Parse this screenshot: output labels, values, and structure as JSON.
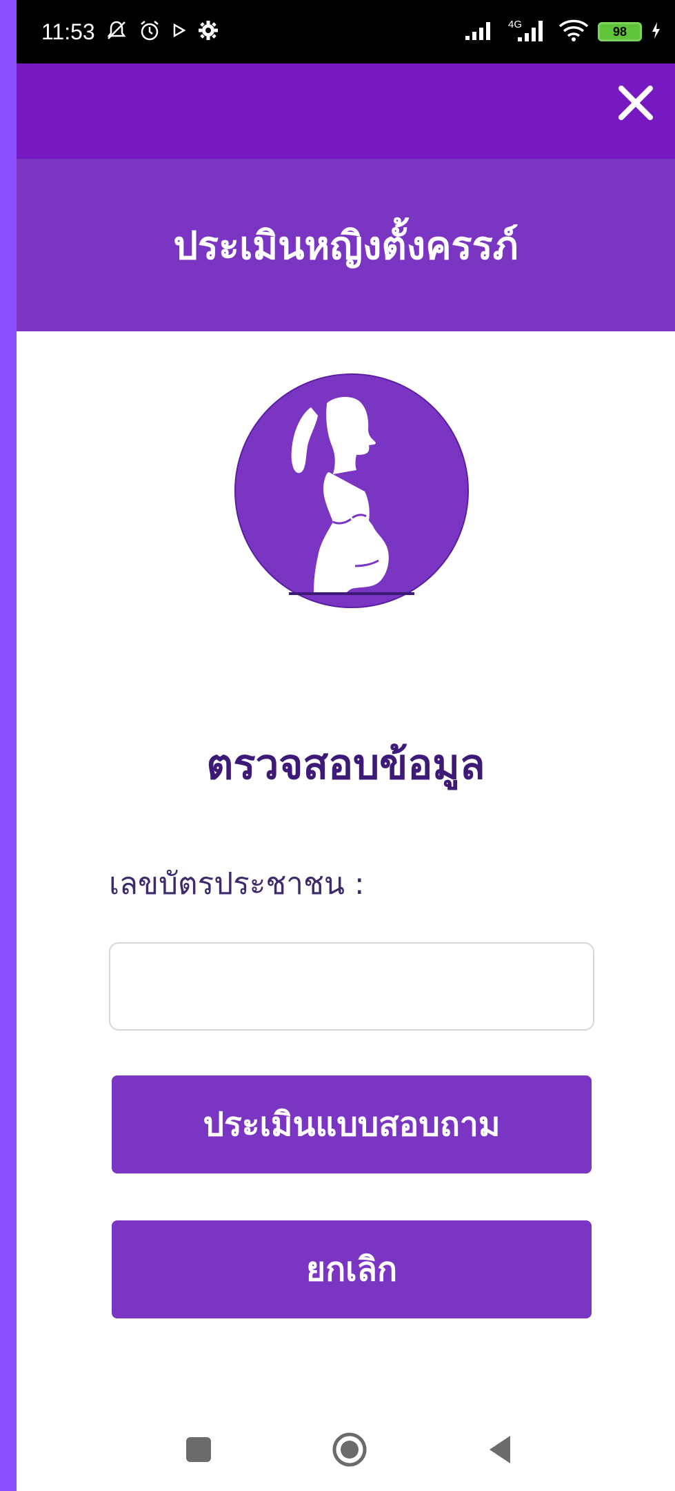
{
  "status_bar": {
    "time": "11:53",
    "network_type": "4G",
    "battery_level": "98",
    "icons": [
      "notifications-off-icon",
      "alarm-icon",
      "play-icon",
      "settings-icon",
      "signal-icon",
      "signal-4g-icon",
      "wifi-icon",
      "battery-icon",
      "charging-icon"
    ]
  },
  "header": {
    "close_icon": "close-icon",
    "title": "ประเมินหญิงตั้งครรภ์"
  },
  "avatar": {
    "icon": "pregnant-woman-icon"
  },
  "form": {
    "section_title": "ตรวจสอบข้อมูล",
    "id_label": "เลขบัตรประชาชน :",
    "id_value": "",
    "id_placeholder": "",
    "assess_button": "ประเมินแบบสอบถาม",
    "cancel_button": "ยกเลิก"
  },
  "nav": {
    "icons": [
      "recents-icon",
      "home-icon",
      "back-icon"
    ]
  },
  "colors": {
    "app_bar": "#7719C0",
    "title_band": "#7B35C3",
    "avatar_bg": "#7B35C3",
    "button_bg": "#7B35C3",
    "section_title": "#3D1A78",
    "left_strip": "#8A50FF"
  }
}
